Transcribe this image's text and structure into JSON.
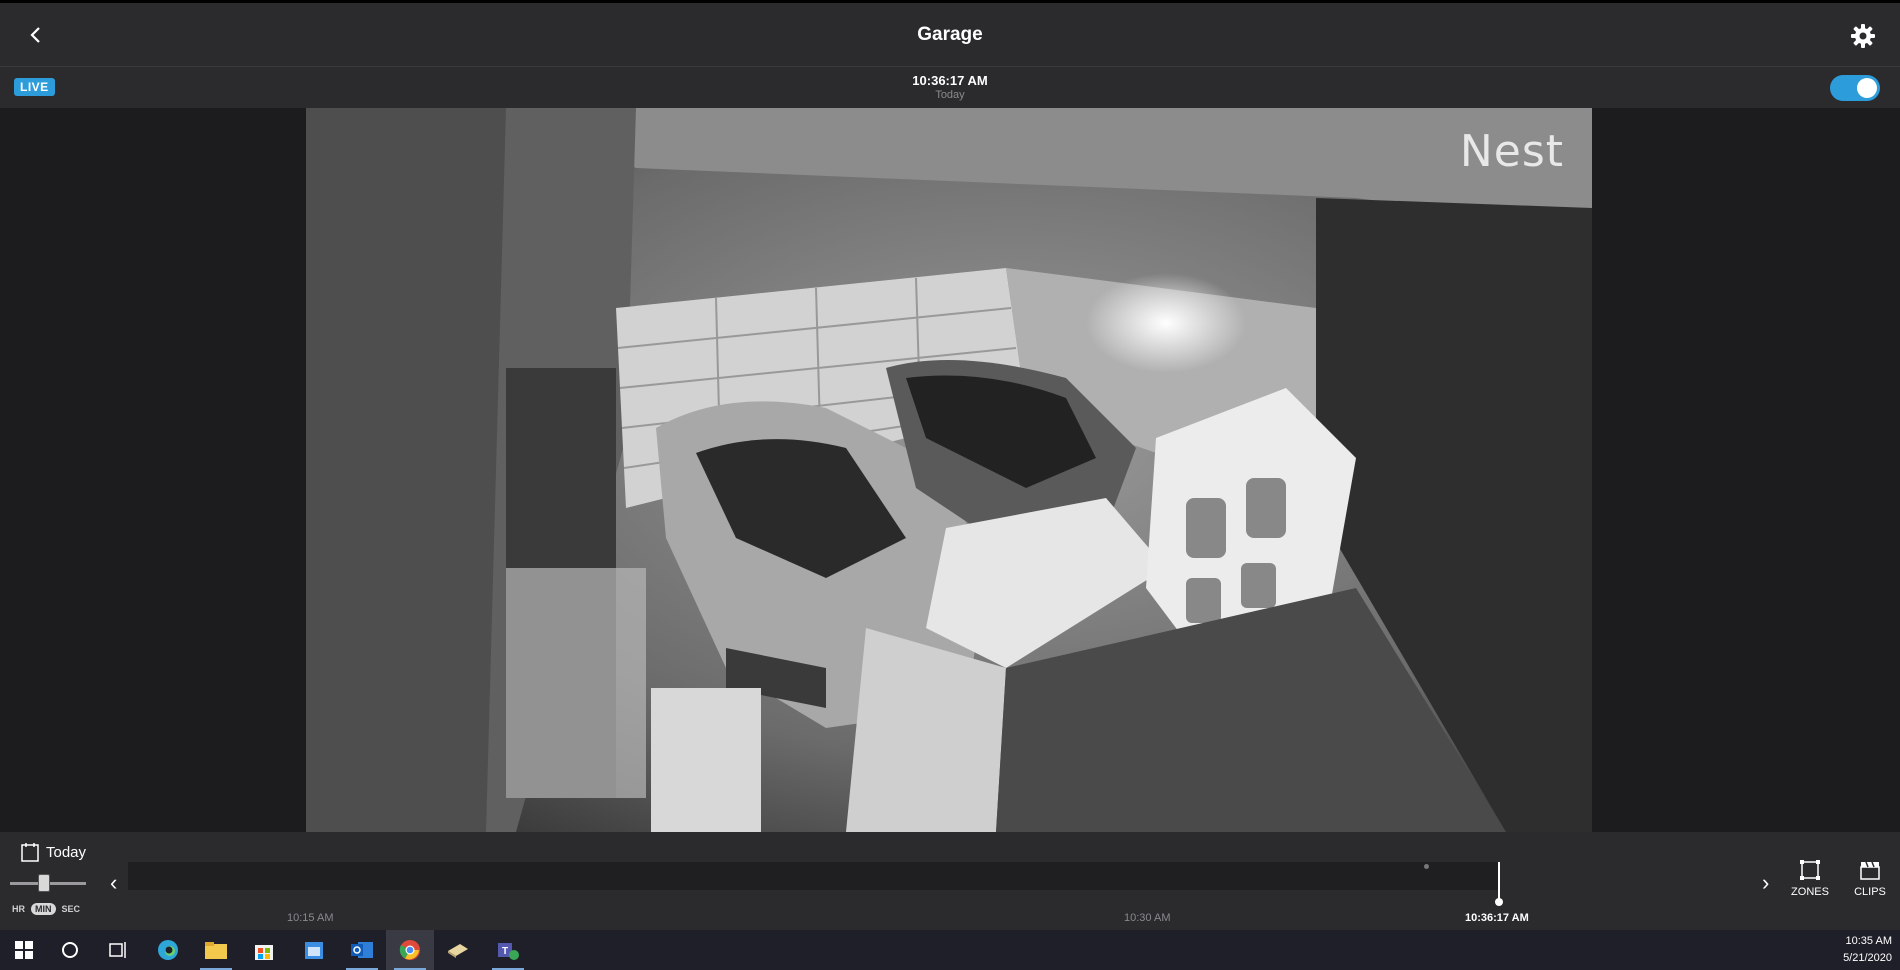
{
  "app": {
    "title": "Garage",
    "back_icon": "chevron-left-icon",
    "settings_icon": "gear-icon"
  },
  "status": {
    "live_label": "LIVE",
    "time": "10:36:17 AM",
    "day": "Today",
    "camera_on": true,
    "accent_color": "#2d9cdb"
  },
  "video": {
    "watermark": "Nest"
  },
  "controls": {
    "date_label": "Today",
    "zoom_levels": [
      "HR",
      "MIN",
      "SEC"
    ],
    "zoom_selected": "MIN",
    "timeline_ticks": [
      "10:15 AM",
      "10:30 AM",
      "10:36:17 AM"
    ],
    "zones_label": "ZONES",
    "clips_label": "CLIPS"
  },
  "taskbar": {
    "apps": [
      "windows-start-icon",
      "cortana-search-icon",
      "task-view-icon",
      "edge-icon",
      "file-explorer-icon",
      "store-icon",
      "calendar-app-icon",
      "outlook-icon",
      "chrome-icon",
      "notes-icon",
      "teams-icon"
    ],
    "clock_time": "10:35 AM",
    "clock_date": "5/21/2020"
  }
}
